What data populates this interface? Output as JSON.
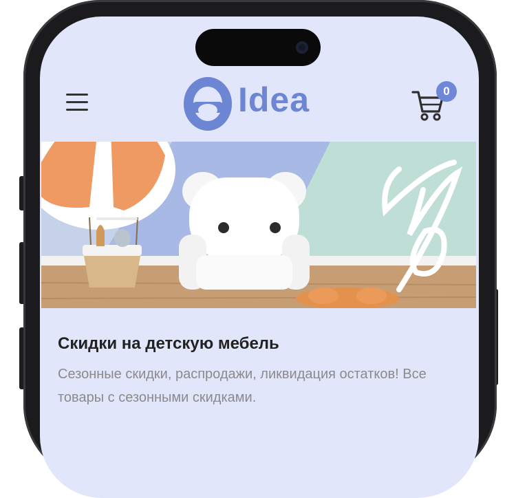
{
  "header": {
    "menu_icon": "hamburger-menu-icon",
    "logo_text": "Idea",
    "cart_icon": "shopping-cart-icon",
    "cart_count": "0"
  },
  "banner": {
    "image": "kids-furniture-sale-banner",
    "promo_symbol": "%"
  },
  "promo": {
    "title": "Скидки на детскую мебель",
    "description": "Сезонные скидки, распродажи, ликвидация остатков! Все товары с сезонными скидками."
  },
  "colors": {
    "accent": "#6c86d4",
    "screen_background": "#e2e6fb",
    "title": "#222222",
    "description": "#8a8a8a"
  }
}
